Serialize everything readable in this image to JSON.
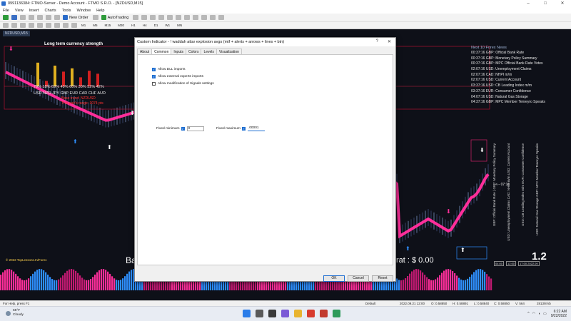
{
  "window": {
    "title": "0991136384: FTMO-Server - Demo Account - FTMO S.R.O. - [NZDUSD,M15]",
    "controls": [
      "–",
      "□",
      "✕"
    ]
  },
  "menu": [
    "File",
    "View",
    "Insert",
    "Charts",
    "Tools",
    "Window",
    "Help"
  ],
  "toolbar": {
    "new_order": "New Order",
    "autotrading": "AutoTrading",
    "timeframes": [
      "M1",
      "M5",
      "M15",
      "M30",
      "H1",
      "H4",
      "D1",
      "W1",
      "MN"
    ]
  },
  "chart": {
    "tab_label": "NZDUSD,M15",
    "strength_title": "Long term currency strength",
    "strength": {
      "percents": "79% 18% 69% 49% 60% 30% 52% 42%",
      "currencies": "USD NZD  JPY GBP EUR CAD CHF AUD",
      "values": [
        79,
        18,
        69,
        49,
        60,
        30,
        52,
        42
      ]
    },
    "red_line1": "Base trend: NZDUSD",
    "red_line2": "This pair's range: 3074 pts",
    "news_header": "Next 10 Forex News",
    "news": [
      "00:37:16  GBP: Official Bank Rate",
      "00:37:16  GBP: Monetary Policy Summary",
      "00:37:16  GBP: MPC Official Bank Rate Votes",
      "02:07:16  USD: Unemployment Claims",
      "02:07:16  CAD: NHPI m/m",
      "02:07:16  USD: Current Account",
      "03:37:16  USD: CB Leading Index m/m",
      "03:37:16  EUR: Consumer Confidence",
      "04:07:16  USD: Natural Gas Storage",
      "04:37:16  GBP: MPC Member Tenreyro Speaks"
    ],
    "vertical_texts": [
      "GBP: Official Bank Rate | GBP: Monetary Policy Summary",
      "USD: Unemployment Claims   CAD: NHPI m/m   USD: Current Account",
      "USD: CB Leading Index m/m   EUR: Consumer Confidence",
      "USD: Natural Gas Storage   GBP: MPC Member Tenreyro Speaks"
    ],
    "timer": "<-- 07:16",
    "ratio": "1.2",
    "bal_partial": "Ba",
    "money_partial": "rat : $ 0.00",
    "copyright": "© 2022 TopLessons.In/Forex",
    "xlabels": [
      "04:00",
      "12:00",
      "17:00 2022.09"
    ]
  },
  "dialog": {
    "title": "Custom Indicator - ! waddah attar explosion avgs (mtf + alerts + arrows + lines + btn)",
    "help": "?",
    "close": "✕",
    "tabs": [
      "About",
      "Common",
      "Inputs",
      "Colors",
      "Levels",
      "Visualization"
    ],
    "active_tab": "Common",
    "checkboxes": [
      {
        "label": "Allow DLL imports",
        "checked": true
      },
      {
        "label": "Allow external experts imports",
        "checked": true
      },
      {
        "label": "Allow modification of Signals settings",
        "checked": false
      }
    ],
    "fixed_min_label": "Fixed minimum",
    "fixed_min_value": "0",
    "fixed_max_label": "Fixed maximum",
    "fixed_max_value": ".00001",
    "ok": "OK",
    "cancel": "Cancel",
    "reset": "Reset"
  },
  "status": {
    "help": "For Help, press F1",
    "profile": "Default",
    "datetime": "2022.09.21 12:00",
    "open": "O: 0.58850",
    "high": "H: 0.58891",
    "low": "L: 0.58840",
    "close": "C: 0.58850",
    "volume": "V: 564",
    "traffic": "2813/8 kb"
  },
  "taskbar": {
    "temp": "65°F",
    "condition": "Cloudy",
    "time": "6:22 AM",
    "date": "9/22/2022"
  },
  "colors": {
    "chart_bg": "#0e1018",
    "pink": "#ff2e9a",
    "blue": "#2e8fff",
    "bar_yellow": "#e0b020",
    "bar_red": "#d02020"
  }
}
